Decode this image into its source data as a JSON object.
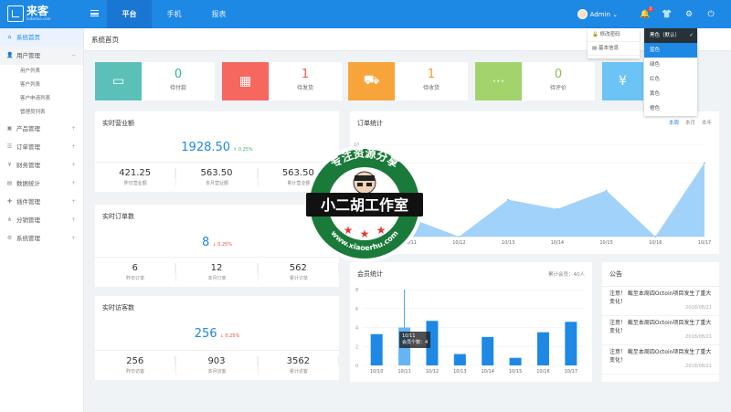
{
  "brand": {
    "name": "来客",
    "sub": "laikeduo.com"
  },
  "nav": {
    "tabs": [
      {
        "label": "平台",
        "active": true
      },
      {
        "label": "手机"
      },
      {
        "label": "报表"
      }
    ]
  },
  "topright": {
    "user": "Admin",
    "bell_badge": "2"
  },
  "sidebar": {
    "items": [
      {
        "label": "系统首页",
        "icon": "home-icon",
        "active": true
      },
      {
        "label": "用户管理",
        "icon": "user-icon",
        "open": true,
        "sub": [
          "用户列表",
          "客户列表",
          "客户申请列表",
          "管理员列表"
        ]
      },
      {
        "label": "产品管理",
        "icon": "box-icon"
      },
      {
        "label": "订单管理",
        "icon": "order-icon"
      },
      {
        "label": "财务管理",
        "icon": "finance-icon"
      },
      {
        "label": "数据统计",
        "icon": "stats-icon"
      },
      {
        "label": "插件管理",
        "icon": "plugin-icon"
      },
      {
        "label": "分销管理",
        "icon": "share-icon"
      },
      {
        "label": "系统管理",
        "icon": "settings-icon"
      }
    ]
  },
  "breadcrumb": "系统首页",
  "stats": [
    {
      "num": "0",
      "label": "待付款",
      "color": "#5bc0b8",
      "icon": "wallet-icon",
      "numColor": "#2bb3a6"
    },
    {
      "num": "1",
      "label": "待发货",
      "color": "#f5675f",
      "icon": "package-icon",
      "numColor": "#f05a4f"
    },
    {
      "num": "1",
      "label": "待收货",
      "color": "#f7a43a",
      "icon": "truck-icon",
      "numColor": "#f39c2a"
    },
    {
      "num": "0",
      "label": "待评价",
      "color": "#a3d36c",
      "icon": "comment-icon",
      "numColor": "#8cc152"
    },
    {
      "num": "",
      "label": "",
      "color": "#6cc3f5",
      "icon": "yen-icon",
      "numColor": "#1e88e5"
    }
  ],
  "revenue": {
    "title": "实时营业额",
    "value": "1928.50",
    "delta": "↑ 0.25%",
    "sub": [
      {
        "v": "421.25",
        "l": "昨日营业额"
      },
      {
        "v": "563.50",
        "l": "本月营业额"
      },
      {
        "v": "563.50",
        "l": "累计营业额"
      }
    ]
  },
  "orders": {
    "title": "实时订单数",
    "value": "8",
    "delta": "↓ 0.25%",
    "sub": [
      {
        "v": "6",
        "l": "昨日订单"
      },
      {
        "v": "12",
        "l": "本月订单"
      },
      {
        "v": "562",
        "l": "累计订单"
      }
    ]
  },
  "visitors": {
    "title": "实时访客数",
    "value": "256",
    "delta": "↓ 0.25%",
    "sub": [
      {
        "v": "256",
        "l": "昨日访客"
      },
      {
        "v": "903",
        "l": "本月访客"
      },
      {
        "v": "3562",
        "l": "累计访客"
      }
    ]
  },
  "order_chart": {
    "title": "订单统计",
    "tabs": [
      "本周",
      "本月",
      "本年"
    ]
  },
  "member_chart": {
    "title": "会员统计",
    "total": "累计会员：40人",
    "tooltip": [
      "10/11",
      "会员个数：4"
    ]
  },
  "notice": {
    "title": "公告",
    "items": [
      {
        "text": "注意！ 截至本周四Octoin项目发生了重大变化！",
        "date": "2018/08/21"
      },
      {
        "text": "注意！ 截至本周四Octoin项目发生了重大变化！",
        "date": "2018/08/21"
      },
      {
        "text": "注意！ 截至本周四Octoin项目发生了重大变化！",
        "date": "2018/08/21"
      }
    ]
  },
  "user_menu": [
    "修改密码",
    "基本信息"
  ],
  "theme_menu": {
    "current": "黑色（默认）",
    "options": [
      "蓝色",
      "绿色",
      "红色",
      "黄色",
      "橙色"
    ],
    "selected": "蓝色"
  },
  "watermark": {
    "top": "专注资源分享",
    "middle": "小二胡工作室",
    "bottom": "www.xiaoerhu.com"
  },
  "chart_data": [
    {
      "type": "area",
      "title": "订单统计",
      "x": [
        "10/10",
        "10/11",
        "10/12",
        "10/13",
        "10/14",
        "10/15",
        "10/16",
        "10/17"
      ],
      "ylim": [
        0,
        10
      ],
      "yticks": [
        10,
        8
      ],
      "series": [
        {
          "values": [
            9,
            2,
            0,
            4,
            3,
            5,
            0,
            8
          ]
        }
      ]
    },
    {
      "type": "bar",
      "title": "会员统计",
      "categories": [
        "10/10",
        "10/11",
        "10/12",
        "10/13",
        "10/14",
        "10/15",
        "10/16",
        "10/17"
      ],
      "ylim": [
        0,
        8
      ],
      "yticks": [
        8,
        6,
        4,
        2,
        0
      ],
      "series": [
        {
          "values": [
            3.3,
            4,
            4.7,
            1.2,
            3,
            0.8,
            3.5,
            4.6
          ]
        }
      ]
    }
  ]
}
